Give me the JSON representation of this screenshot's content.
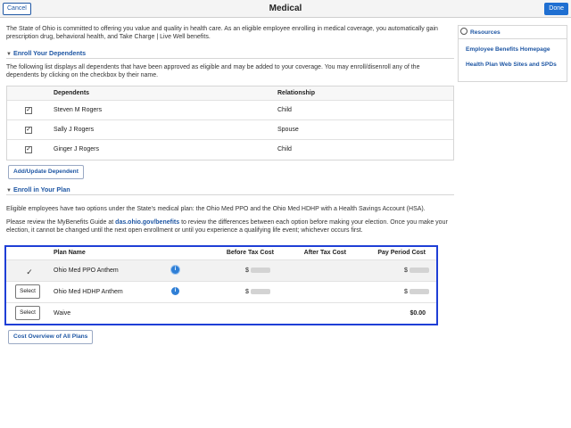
{
  "header": {
    "cancel_label": "Cancel",
    "title": "Medical",
    "done_label": "Done"
  },
  "intro_text": "The State of Ohio is committed to offering you value and quality in health care. As an eligible employee enrolling in medical coverage, you automatically gain prescription drug, behavioral health, and Take Charge | Live Well benefits.",
  "dependents_section": {
    "title": "Enroll Your Dependents",
    "description": "The following list displays all dependents that have been approved as eligible and may be added to your coverage. You may enroll/disenroll any of the dependents by clicking on the checkbox by their name.",
    "columns": [
      "Dependents",
      "Relationship"
    ],
    "rows": [
      {
        "name": "Steven M Rogers",
        "relationship": "Child",
        "checked": "✓"
      },
      {
        "name": "Sally J Rogers",
        "relationship": "Spouse",
        "checked": "✓"
      },
      {
        "name": "Ginger J Rogers",
        "relationship": "Child",
        "checked": "✓"
      }
    ],
    "add_button": "Add/Update Dependent"
  },
  "plan_section": {
    "title": "Enroll in Your Plan",
    "description": "Eligible employees have two options under the State's medical plan: the Ohio Med PPO and the Ohio Med HDHP with a Health Savings Account (HSA).",
    "guide_pre": "Please review the MyBenefits Guide at ",
    "guide_link": "das.ohio.gov/benefits",
    "guide_post": " to review the differences between each option before making your election. Once you make your election, it cannot be changed until the next open enrollment or until you experience a qualifying life event; whichever occurs first.",
    "columns": {
      "plan_name": "Plan Name",
      "before_tax": "Before Tax Cost",
      "after_tax": "After Tax Cost",
      "pay_period": "Pay Period Cost"
    },
    "rows": [
      {
        "name": "Ohio Med PPO Anthem",
        "selected": true,
        "before_prefix": "$",
        "pay_prefix": "$"
      },
      {
        "name": "Ohio Med HDHP Anthem",
        "select_label": "Select",
        "before_prefix": "$",
        "pay_prefix": "$"
      },
      {
        "name": "Waive",
        "select_label": "Select",
        "pay_amount": "$0.00"
      }
    ],
    "overview_button": "Cost Overview of All Plans"
  },
  "resources": {
    "title": "Resources",
    "links": [
      "Employee Benefits Homepage",
      "Health Plan Web Sites and SPDs"
    ]
  },
  "colors": {
    "accent": "#1f57a4",
    "done_button": "#1f6fd1",
    "plan_box_border": "#1f3fd6"
  },
  "icons": {
    "expanded": "triangle-down-icon",
    "info": "info-icon",
    "globe": "globe-icon",
    "selected": "checkmark-icon"
  }
}
